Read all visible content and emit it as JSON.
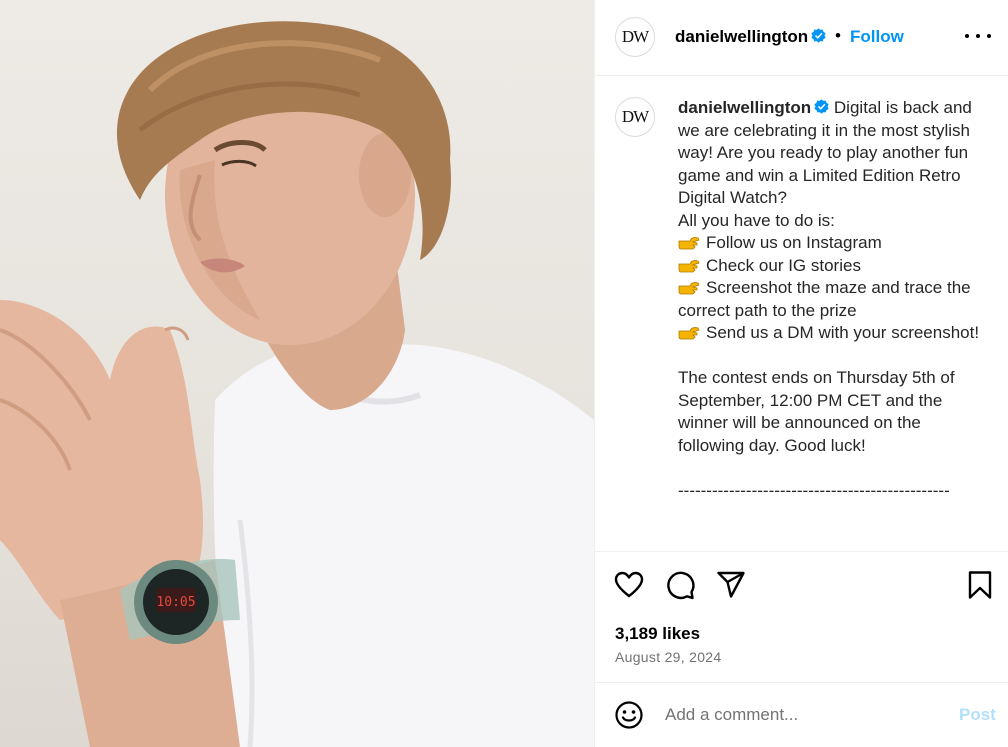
{
  "post": {
    "image_alt": "Young man in white t-shirt wearing a transparent digital watch"
  },
  "header": {
    "avatar_text": "DW",
    "username": "danielwellington",
    "separator": "•",
    "follow_label": "Follow",
    "more_icon": "more-horizontal-icon"
  },
  "caption": {
    "avatar_text": "DW",
    "username": "danielwellington",
    "intro": "Digital is back and we are celebrating it in the most stylish way! Are you ready to play another fun game and win a Limited Edition Retro Digital Watch?",
    "instruction": "All you have to do is:",
    "steps": [
      "Follow us on Instagram",
      "Check our IG stories",
      "Screenshot the maze and trace the correct path to the prize",
      "Send us a DM with your screenshot!"
    ],
    "closing": "The contest ends on Thursday 5th of September, 12:00 PM CET and the winner will be announced on the following day. Good luck!",
    "divider": "------------------------------------------------"
  },
  "actions": {
    "likes": "3,189 likes",
    "date": "August 29, 2024"
  },
  "comment": {
    "placeholder": "Add a comment...",
    "post_label": "Post"
  },
  "colors": {
    "accent": "#0095f6",
    "verified": "#0095f6",
    "post_disabled": "#b2dffc",
    "muted_text": "#737373",
    "pointing_emoji": "#f4b400"
  }
}
